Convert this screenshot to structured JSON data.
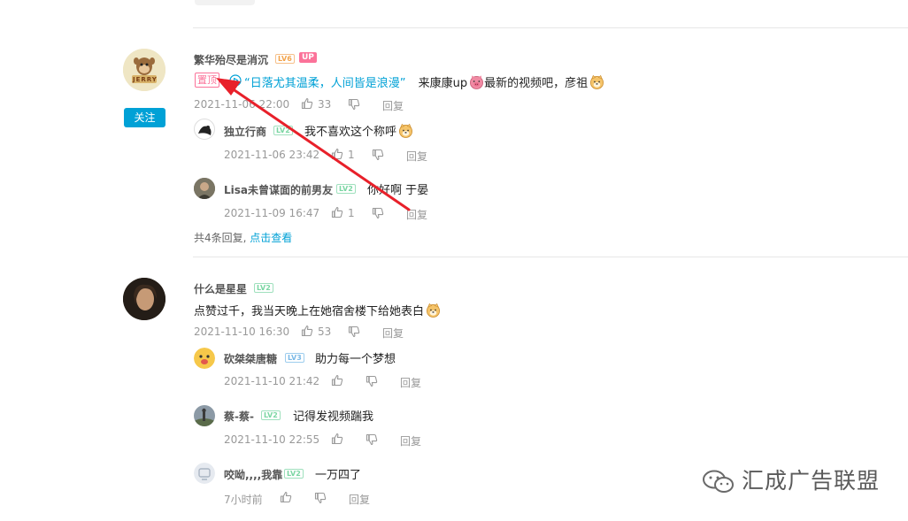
{
  "comments": [
    {
      "user": "繁华殆尽是消沉",
      "level": "LV6",
      "up_badge": "UP",
      "pinned_label": "置顶",
      "video_link": "“日落尤其温柔，人间皆是浪漫”",
      "text": "来康康up",
      "text2": "最新的视频吧，彦祖",
      "time": "2021-11-06 22:00",
      "likes": "33",
      "reply_label": "回复",
      "follow_label": "关注",
      "replies": [
        {
          "user": "独立行商",
          "level": "LV2",
          "text": "我不喜欢这个称呼",
          "time": "2021-11-06 23:42",
          "likes": "1",
          "reply_label": "回复"
        },
        {
          "user": "Lisa未曾谋面的前男友",
          "level": "LV2",
          "text": "你好啊 于晏",
          "time": "2021-11-09 16:47",
          "likes": "1",
          "reply_label": "回复"
        }
      ],
      "more_prefix": "共4条回复,",
      "more_link": "点击查看"
    },
    {
      "user": "什么是星星",
      "level": "LV2",
      "text": "点赞过千，我当天晚上在她宿舍楼下给她表白",
      "time": "2021-11-10 16:30",
      "likes": "53",
      "reply_label": "回复",
      "replies": [
        {
          "user": "砍桀桀唐糖",
          "level": "LV3",
          "text": "助力每一个梦想",
          "time": "2021-11-10 21:42",
          "likes": "",
          "reply_label": "回复"
        },
        {
          "user": "蔡-蔡-",
          "level": "LV2",
          "text": "记得发视频踹我",
          "time": "2021-11-10 22:55",
          "likes": "",
          "reply_label": "回复"
        },
        {
          "user": "咬呦,,,,我靠",
          "level": "LV2",
          "text": "一万四了",
          "time": "7小时前",
          "likes": "",
          "reply_label": "回复"
        }
      ]
    }
  ],
  "watermark": "汇成广告联盟",
  "colors": {
    "accent": "#00a1d6",
    "pink": "#fb7299",
    "arrow": "#e8202a"
  }
}
